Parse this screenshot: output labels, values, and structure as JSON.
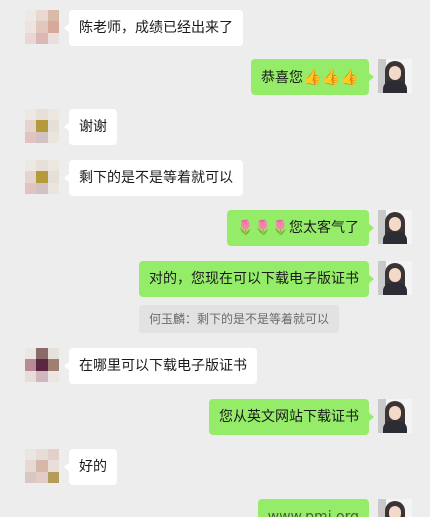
{
  "messages": [
    {
      "side": "in",
      "text": "陈老师，成绩已经出来了"
    },
    {
      "side": "out",
      "text": "恭喜您",
      "emoji": "👍👍👍"
    },
    {
      "side": "in",
      "text": "谢谢"
    },
    {
      "side": "in",
      "text": "剩下的是不是等着就可以"
    },
    {
      "side": "out",
      "prefix": "🌷🌷🌷",
      "text": "您太客气了"
    },
    {
      "side": "out",
      "text": "对的，您现在可以下载电子版证书"
    },
    {
      "quote": "何玉麟：剩下的是不是等着就可以"
    },
    {
      "side": "in",
      "text": "在哪里可以下载电子版证书"
    },
    {
      "side": "out",
      "text": "您从英文网站下载证书"
    },
    {
      "side": "in",
      "text": "好的"
    },
    {
      "side": "out",
      "text": "www.pmi.org"
    }
  ],
  "colors": {
    "background": "#ededed",
    "bubble_in": "#ffffff",
    "bubble_out": "#95ec69",
    "quote_bg": "#e2e2e2"
  }
}
